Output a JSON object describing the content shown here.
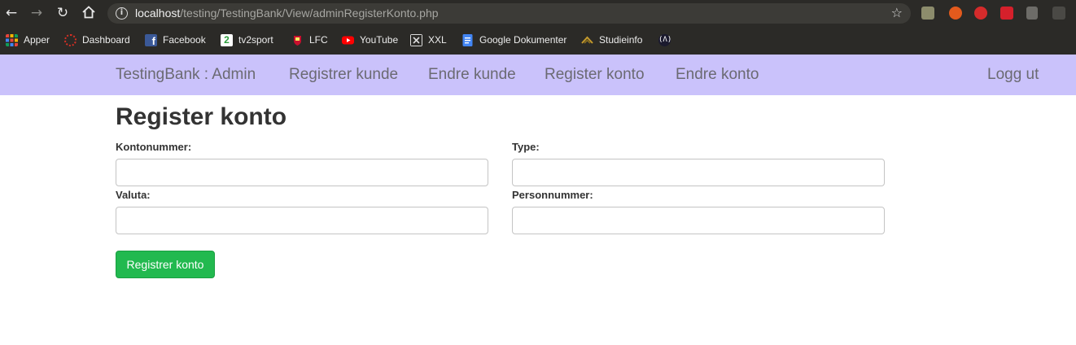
{
  "browser": {
    "url_host": "localhost",
    "url_path": "/testing/TestingBank/View/adminRegisterKonto.php",
    "bookmarks": [
      {
        "label": "Apper",
        "icon": "apps-grid-icon",
        "color": "#e8453c"
      },
      {
        "label": "Dashboard",
        "icon": "dashboard-ring-icon",
        "color": "#d93025"
      },
      {
        "label": "Facebook",
        "icon": "facebook-icon",
        "color": "#3b5998"
      },
      {
        "label": "tv2sport",
        "icon": "tv2-icon",
        "color": "#4caf50"
      },
      {
        "label": "LFC",
        "icon": "lfc-crest-icon",
        "color": "#c8102e"
      },
      {
        "label": "YouTube",
        "icon": "youtube-icon",
        "color": "#ff0000"
      },
      {
        "label": "XXL",
        "icon": "xxl-icon",
        "color": "#dcdcdc"
      },
      {
        "label": "Google Dokumenter",
        "icon": "google-docs-icon",
        "color": "#4285f4"
      },
      {
        "label": "Studieinfo",
        "icon": "studieinfo-icon",
        "color": "#c49a2c"
      },
      {
        "label": "",
        "icon": "angular-bracket-icon",
        "color": "#ffffff"
      }
    ]
  },
  "navbar": {
    "brand": "TestingBank : Admin",
    "links": [
      "Registrer kunde",
      "Endre kunde",
      "Register konto",
      "Endre konto"
    ],
    "logout": "Logg ut",
    "background": "#cac2fb"
  },
  "page": {
    "title": "Register konto",
    "fields": {
      "kontonummer": {
        "label": "Kontonummer:",
        "value": ""
      },
      "type": {
        "label": "Type:",
        "value": ""
      },
      "valuta": {
        "label": "Valuta:",
        "value": ""
      },
      "personnummer": {
        "label": "Personnummer:",
        "value": ""
      }
    },
    "submit_label": "Registrer konto",
    "submit_color": "#22b94f"
  }
}
